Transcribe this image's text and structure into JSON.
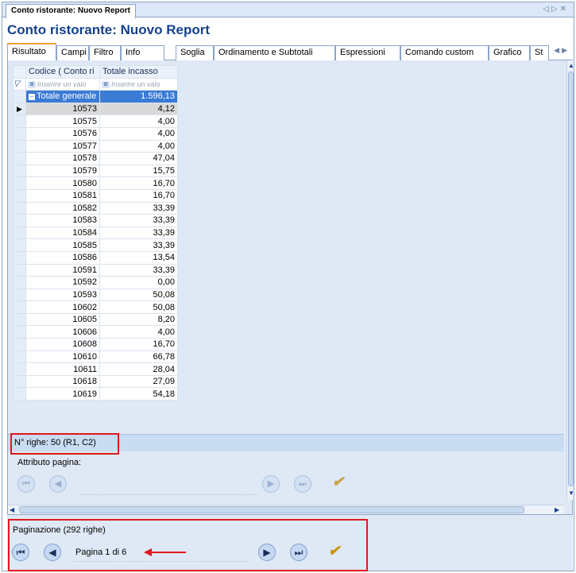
{
  "document_tab": {
    "title": "Conto ristorante: Nuovo Report"
  },
  "doc_nav": {
    "prev": "◁",
    "next": "▷",
    "close": "✕"
  },
  "report_title": "Conto ristorante: Nuovo Report",
  "tabs": [
    {
      "label": "Risultato",
      "active": true
    },
    {
      "label": "Campi"
    },
    {
      "label": "Filtro"
    },
    {
      "label": "Info"
    },
    {
      "label": "Soglia"
    },
    {
      "label": "Ordinamento e Subtotali"
    },
    {
      "label": "Espressioni"
    },
    {
      "label": "Comando custom"
    },
    {
      "label": "Grafico"
    },
    {
      "label": "St"
    }
  ],
  "grid": {
    "columns": [
      "Codice ( Conto ri",
      "Totale incasso"
    ],
    "filter_placeholder": "Inserire un valo",
    "total_label": "Totale generale",
    "total_value": "1.596,13",
    "rows": [
      {
        "codice": "10573",
        "totale": "4,12"
      },
      {
        "codice": "10575",
        "totale": "4,00"
      },
      {
        "codice": "10576",
        "totale": "4,00"
      },
      {
        "codice": "10577",
        "totale": "4,00"
      },
      {
        "codice": "10578",
        "totale": "47,04"
      },
      {
        "codice": "10579",
        "totale": "15,75"
      },
      {
        "codice": "10580",
        "totale": "16,70"
      },
      {
        "codice": "10581",
        "totale": "16,70"
      },
      {
        "codice": "10582",
        "totale": "33,39"
      },
      {
        "codice": "10583",
        "totale": "33,39"
      },
      {
        "codice": "10584",
        "totale": "33,39"
      },
      {
        "codice": "10585",
        "totale": "33,39"
      },
      {
        "codice": "10586",
        "totale": "13,54"
      },
      {
        "codice": "10591",
        "totale": "33,39"
      },
      {
        "codice": "10592",
        "totale": "0,00"
      },
      {
        "codice": "10593",
        "totale": "50,08"
      },
      {
        "codice": "10602",
        "totale": "50,08"
      },
      {
        "codice": "10605",
        "totale": "8,20"
      },
      {
        "codice": "10606",
        "totale": "4,00"
      },
      {
        "codice": "10608",
        "totale": "16,70"
      },
      {
        "codice": "10610",
        "totale": "66,78"
      },
      {
        "codice": "10611",
        "totale": "28,04"
      },
      {
        "codice": "10618",
        "totale": "27,09"
      },
      {
        "codice": "10619",
        "totale": "54,18"
      }
    ]
  },
  "row_count": "N° righe: 50  (R1, C2)",
  "attribute_label": "Attributo pagina:",
  "pagination": {
    "label": "Paginazione (292 righe)",
    "page_text": "Pagina 1 di 6"
  },
  "icons": {
    "first": "⏮",
    "prev": "◀",
    "next": "▶",
    "last": "⏭",
    "apply": "✔"
  },
  "colors": {
    "accent_blue": "#15428b",
    "selection": "#3a7bd5",
    "annotation_red": "#e0181e",
    "apply_gold": "#c89400"
  }
}
